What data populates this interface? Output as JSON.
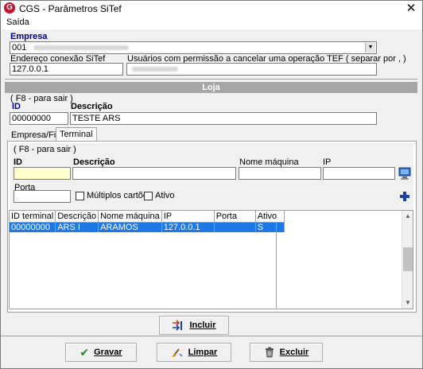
{
  "window": {
    "title": "CGS - Parâmetros SiTef",
    "app_icon": "G",
    "close_glyph": "✕"
  },
  "menu": {
    "items": [
      "Saída"
    ]
  },
  "empresa": {
    "label": "Empresa",
    "value": "001",
    "endereco_label": "Endereço conexão SiTef",
    "endereco_value": "127.0.0.1",
    "usuarios_label": "Usuários com permissão a cancelar uma operação TEF ( separar por , )"
  },
  "loja": {
    "header": "Loja",
    "hint": "( F8 - para sair )",
    "id_label": "ID",
    "descricao_label": "Descrição",
    "id_value": "00000000",
    "descricao_value": "TESTE ARS"
  },
  "tabs": [
    {
      "label": "Empresa/Filial",
      "active": false
    },
    {
      "label": "Terminal",
      "active": true
    }
  ],
  "terminal": {
    "hint": "( F8 - para sair )",
    "id_label": "ID",
    "descricao_label": "Descrição",
    "nome_maquina_label": "Nome máquina",
    "ip_label": "IP",
    "porta_label": "Porta",
    "multiplos_label": "Múltiplos cartões",
    "ativo_label": "Ativo"
  },
  "grid": {
    "columns": [
      "ID terminal",
      "Descrição",
      "Nome máquina",
      "IP",
      "Porta",
      "Ativo"
    ],
    "rows": [
      [
        "00000000",
        "ARS I",
        "ARAMOS",
        "127.0.0.1",
        "",
        "S"
      ]
    ]
  },
  "buttons": {
    "incluir": "Incluir",
    "gravar": "Gravar",
    "limpar": "Limpar",
    "excluir": "Excluir"
  },
  "colors": {
    "selection": "#1e78e6",
    "focus_input": "#ffffcc",
    "header_bar": "#a6a6a6",
    "label_navy": "#00007f"
  }
}
